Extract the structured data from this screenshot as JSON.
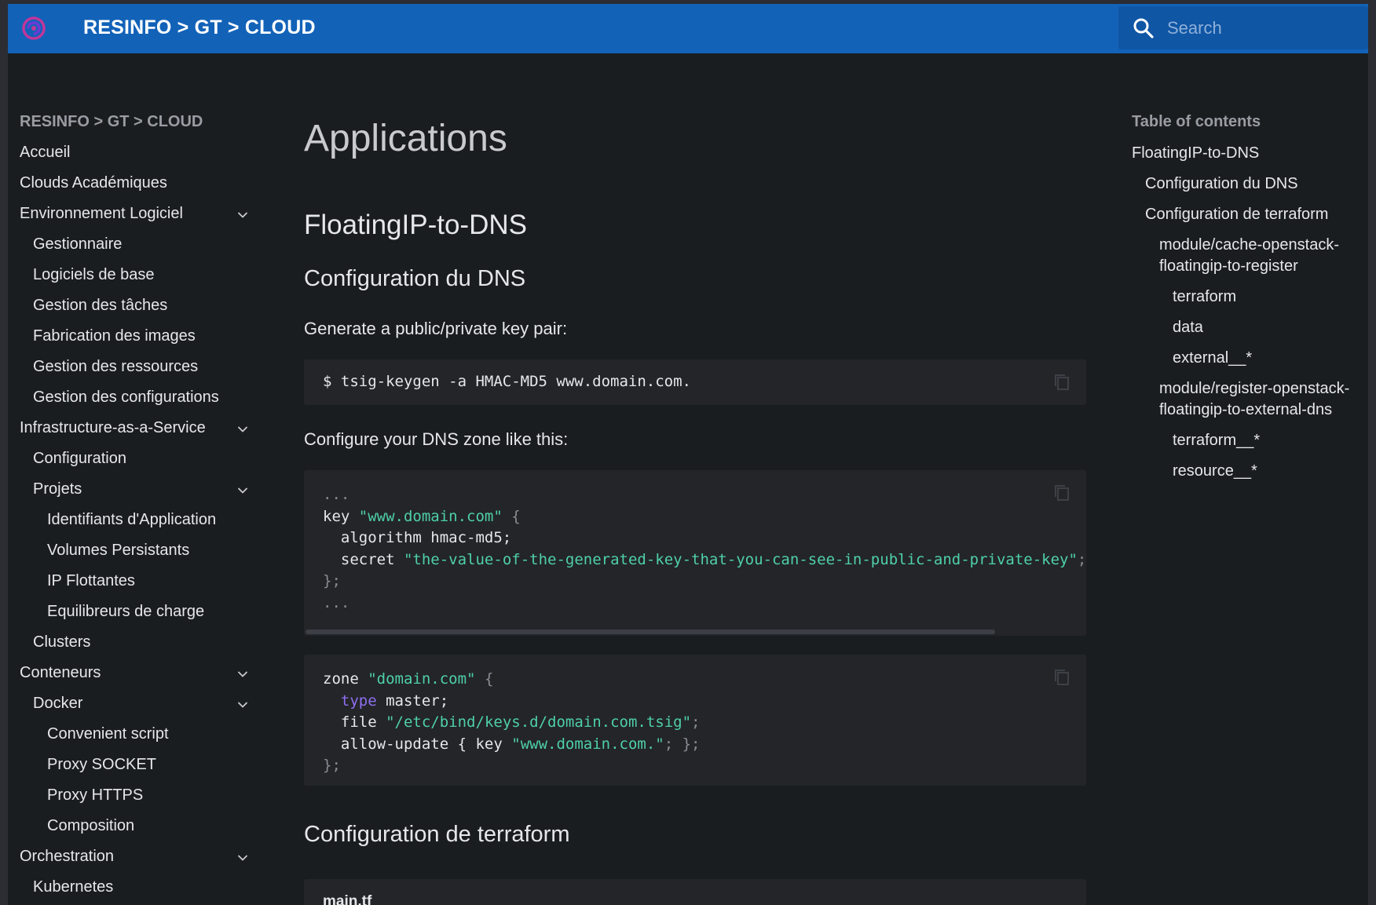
{
  "header": {
    "site_title": "RESINFO > GT > CLOUD",
    "search_placeholder": "Search"
  },
  "sidebar": {
    "heading": "RESINFO > GT > CLOUD",
    "items": [
      {
        "label": "Accueil",
        "level": 1,
        "expandable": false
      },
      {
        "label": "Clouds Académiques",
        "level": 1,
        "expandable": false
      },
      {
        "label": "Environnement Logiciel",
        "level": 1,
        "expandable": true
      },
      {
        "label": "Gestionnaire",
        "level": 2,
        "expandable": false
      },
      {
        "label": "Logiciels de base",
        "level": 2,
        "expandable": false
      },
      {
        "label": "Gestion des tâches",
        "level": 2,
        "expandable": false
      },
      {
        "label": "Fabrication des images",
        "level": 2,
        "expandable": false
      },
      {
        "label": "Gestion des ressources",
        "level": 2,
        "expandable": false
      },
      {
        "label": "Gestion des configurations",
        "level": 2,
        "expandable": false
      },
      {
        "label": "Infrastructure-as-a-Service",
        "level": 1,
        "expandable": true
      },
      {
        "label": "Configuration",
        "level": 2,
        "expandable": false
      },
      {
        "label": "Projets",
        "level": 2,
        "expandable": true
      },
      {
        "label": "Identifiants d'Application",
        "level": 3,
        "expandable": false
      },
      {
        "label": "Volumes Persistants",
        "level": 3,
        "expandable": false
      },
      {
        "label": "IP Flottantes",
        "level": 3,
        "expandable": false
      },
      {
        "label": "Equilibreurs de charge",
        "level": 3,
        "expandable": false
      },
      {
        "label": "Clusters",
        "level": 2,
        "expandable": false
      },
      {
        "label": "Conteneurs",
        "level": 1,
        "expandable": true
      },
      {
        "label": "Docker",
        "level": 2,
        "expandable": true
      },
      {
        "label": "Convenient script",
        "level": 3,
        "expandable": false
      },
      {
        "label": "Proxy SOCKET",
        "level": 3,
        "expandable": false
      },
      {
        "label": "Proxy HTTPS",
        "level": 3,
        "expandable": false
      },
      {
        "label": "Composition",
        "level": 3,
        "expandable": false
      },
      {
        "label": "Orchestration",
        "level": 1,
        "expandable": true
      },
      {
        "label": "Kubernetes",
        "level": 2,
        "expandable": false
      }
    ]
  },
  "content": {
    "page_title": "Applications",
    "section_title": "FloatingIP-to-DNS",
    "dns_heading": "Configuration du DNS",
    "para_keygen": "Generate a public/private key pair:",
    "code_keygen": "$ tsig-keygen -a HMAC-MD5 www.domain.com.",
    "para_zone": "Configure your DNS zone like this:",
    "code_key": {
      "ellipsis": "...",
      "kw_key": "key",
      "key_name": "\"www.domain.com\"",
      "algorithm": "algorithm hmac-md5;",
      "kw_secret": "secret",
      "secret_value": "\"the-value-of-the-generated-key-that-you-can-see-in-public-and-private-key\"",
      "close": "};"
    },
    "code_zone": {
      "kw_zone": "zone",
      "zone_name": "\"domain.com\"",
      "kw_type": "type",
      "type_value": "master;",
      "kw_file": "file",
      "file_path": "\"/etc/bind/keys.d/domain.com.tsig\"",
      "allow_update_a": "allow-update { key",
      "allow_update_key": "\"www.domain.com.\"",
      "allow_update_b": "; };",
      "close": "};"
    },
    "terraform_heading": "Configuration de terraform",
    "file_name": "main.tf"
  },
  "toc": {
    "heading": "Table of contents",
    "items": [
      {
        "label": "FloatingIP-to-DNS",
        "level": 1
      },
      {
        "label": "Configuration du DNS",
        "level": 2
      },
      {
        "label": "Configuration de terraform",
        "level": 2
      },
      {
        "label": "module/cache-openstack-floatingip-to-register",
        "level": 3
      },
      {
        "label": "terraform",
        "level": 4
      },
      {
        "label": "data",
        "level": 4
      },
      {
        "label": "external__*",
        "level": 4
      },
      {
        "label": "module/register-openstack-floatingip-to-external-dns",
        "level": 3
      },
      {
        "label": "terraform__*",
        "level": 4
      },
      {
        "label": "resource__*",
        "level": 4
      }
    ]
  },
  "colors": {
    "header_bg": "#1262b8",
    "page_bg": "#1a1d20",
    "code_bg": "#232529",
    "string": "#4fd0a5",
    "keyword": "#8f6ef0"
  }
}
